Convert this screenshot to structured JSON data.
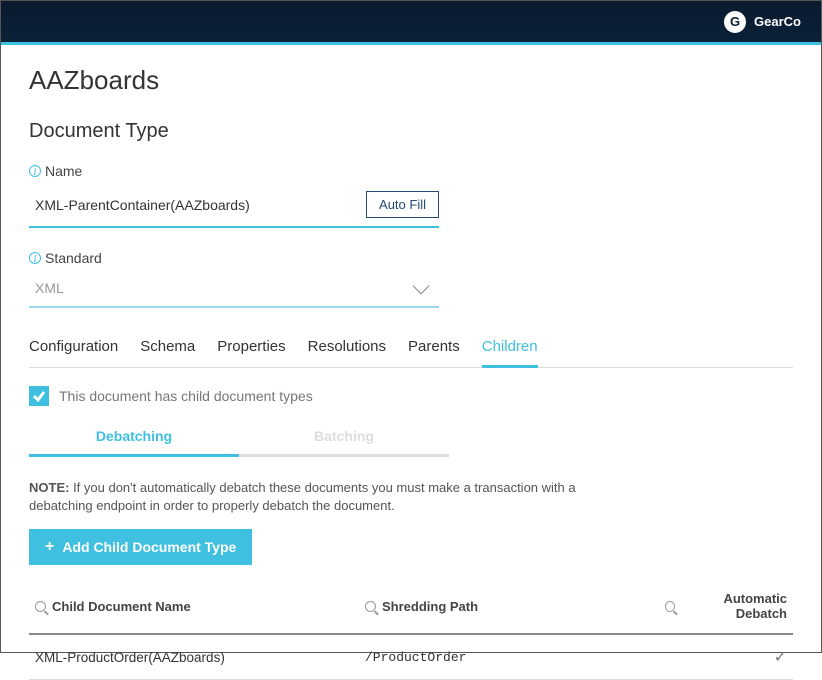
{
  "header": {
    "avatar_letter": "G",
    "username": "GearCo"
  },
  "page": {
    "title": "AAZboards",
    "section_title": "Document Type"
  },
  "fields": {
    "name_label": "Name",
    "name_value": "XML-ParentContainer(AAZboards)",
    "auto_fill_label": "Auto Fill",
    "standard_label": "Standard",
    "standard_value": "XML"
  },
  "tabs": [
    {
      "label": "Configuration",
      "active": false
    },
    {
      "label": "Schema",
      "active": false
    },
    {
      "label": "Properties",
      "active": false
    },
    {
      "label": "Resolutions",
      "active": false
    },
    {
      "label": "Parents",
      "active": false
    },
    {
      "label": "Children",
      "active": true
    }
  ],
  "child_checkbox_label": "This document has child document types",
  "subtabs": {
    "debatching": "Debatching",
    "batching": "Batching"
  },
  "note_prefix": "NOTE:",
  "note_text": " If you don't automatically debatch these documents you must make a transaction with a debatching endpoint in order to properly debatch the document.",
  "add_button_label": "Add Child Document Type",
  "table": {
    "headers": {
      "name": "Child Document Name",
      "path": "Shredding Path",
      "auto": "Automatic Debatch"
    },
    "rows": [
      {
        "name": "XML-ProductOrder(AAZboards)",
        "path": "/ProductOrder",
        "auto": true
      }
    ]
  }
}
